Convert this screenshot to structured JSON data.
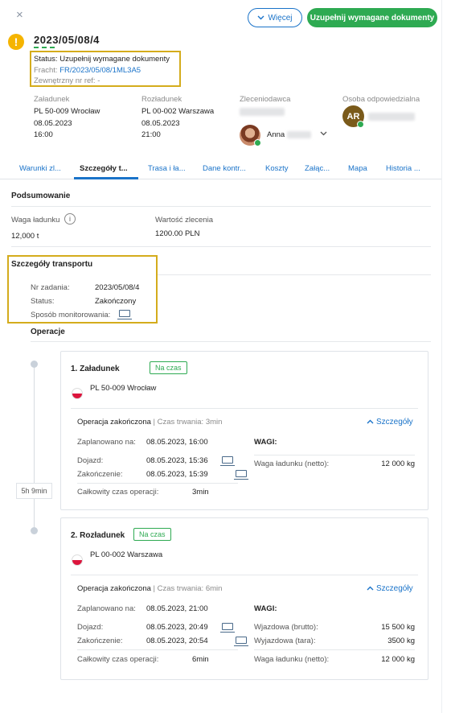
{
  "header": {
    "close_symbol": "×",
    "more_label": "Więcej",
    "main_action_label": "Uzupełnij wymagane dokumenty",
    "order_id": "2023/05/08/4",
    "status_line": "Status: Uzupełnij wymagane dokumenty",
    "freight_label": "Fracht:",
    "freight_value": "FR/2023/05/08/1ML3A5",
    "external_ref": "Zewnętrzny nr ref: -"
  },
  "columns": {
    "loading": {
      "title": "Załadunek",
      "place": "PL 50-009 Wrocław",
      "date": "08.05.2023",
      "time": "16:00"
    },
    "unloading": {
      "title": "Rozładunek",
      "place": "PL 00-002 Warszawa",
      "date": "08.05.2023",
      "time": "21:00"
    },
    "client": {
      "title": "Zleceniodawca",
      "person_name": "Anna"
    },
    "responsible": {
      "title": "Osoba odpowiedzialna",
      "initials": "AR"
    }
  },
  "tabs": [
    {
      "label": "Warunki zl..."
    },
    {
      "label": "Szczegóły t..."
    },
    {
      "label": "Trasa i ła..."
    },
    {
      "label": "Dane kontr..."
    },
    {
      "label": "Koszty"
    },
    {
      "label": "Załąc..."
    },
    {
      "label": "Mapa"
    },
    {
      "label": "Historia ..."
    }
  ],
  "summary": {
    "title": "Podsumowanie",
    "weight_label": "Waga ładunku",
    "weight_value": "12,000 t",
    "value_label": "Wartość zlecenia",
    "value_value": "1200.00 PLN"
  },
  "transport": {
    "title": "Szczegóły transportu",
    "task_label": "Nr zadania:",
    "task_value": "2023/05/08/4",
    "status_label": "Status:",
    "status_value": "Zakończony",
    "monitoring_label": "Sposób monitorowania:"
  },
  "operations": {
    "title": "Operacje",
    "duration": "5h 9min",
    "items": [
      {
        "title": "1. Załadunek",
        "badge": "Na czas",
        "place": "PL 50-009 Wrocław",
        "done": "Operacja zakończona",
        "duration_text": "Czas trwania: 3min",
        "details_label": "Szczegóły",
        "planned_label": "Zaplanowano na:",
        "planned_value": "08.05.2023, 16:00",
        "arrival_label": "Dojazd:",
        "arrival_value": "08.05.2023, 15:36",
        "finish_label": "Zakończenie:",
        "finish_value": "08.05.2023, 15:39",
        "total_label": "Całkowity czas operacji:",
        "total_value": "3min",
        "weights_title": "WAGI:",
        "weights": [
          {
            "label": "Waga ładunku (netto):",
            "value": "12 000 kg"
          }
        ]
      },
      {
        "title": "2. Rozładunek",
        "badge": "Na czas",
        "place": "PL 00-002 Warszawa",
        "done": "Operacja zakończona",
        "duration_text": "Czas trwania: 6min",
        "details_label": "Szczegóły",
        "planned_label": "Zaplanowano na:",
        "planned_value": "08.05.2023, 21:00",
        "arrival_label": "Dojazd:",
        "arrival_value": "08.05.2023, 20:49",
        "finish_label": "Zakończenie:",
        "finish_value": "08.05.2023, 20:54",
        "total_label": "Całkowity czas operacji:",
        "total_value": "6min",
        "weights_title": "WAGI:",
        "weights": [
          {
            "label": "Wjazdowa (brutto):",
            "value": "15 500 kg"
          },
          {
            "label": "Wyjazdowa (tara):",
            "value": "3500 kg"
          },
          {
            "label": "Waga ładunku (netto):",
            "value": "12 000 kg"
          }
        ]
      }
    ]
  }
}
